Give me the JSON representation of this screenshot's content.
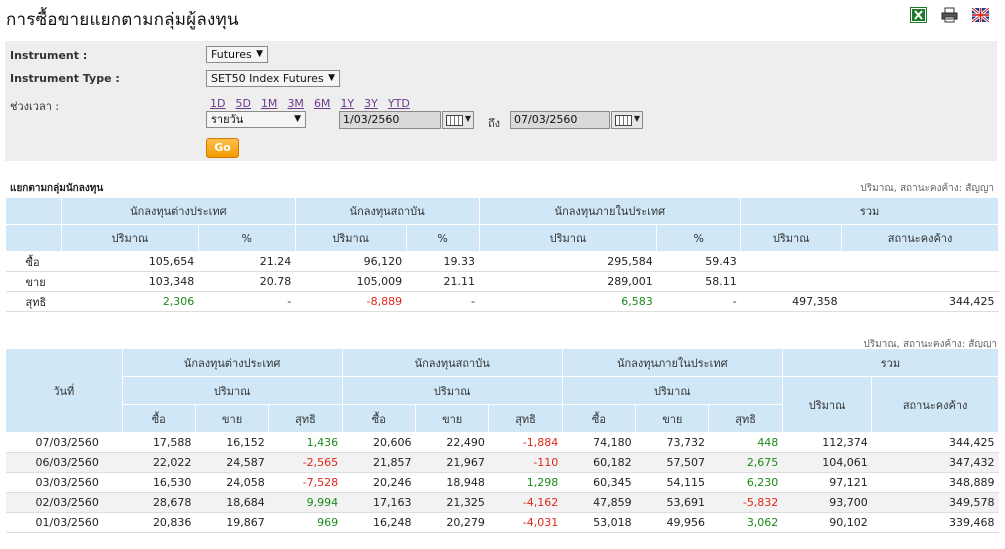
{
  "page": {
    "title": "การซื้อขายแยกตามกลุ่มผู้ลงทุน"
  },
  "icons": [
    "excel-icon",
    "print-icon",
    "uk-flag-icon"
  ],
  "filters": {
    "instrument_label": "Instrument :",
    "instrument_value": "Futures",
    "instrument_type_label": "Instrument Type :",
    "instrument_type_value": "SET50 Index Futures",
    "period_label": "ช่วงเวลา :",
    "periods": [
      "1D",
      "5D",
      "1M",
      "3M",
      "6M",
      "1Y",
      "3Y",
      "YTD"
    ],
    "frequency_value": "รายวัน",
    "from_date": "1/03/2560",
    "to_label": "ถึง",
    "to_date": "07/03/2560",
    "go_label": "Go"
  },
  "summary": {
    "title": "แยกตามกลุ่มนักลงทุน",
    "unit_note": "ปริมาณ, สถานะคงค้าง: สัญญา",
    "groups": [
      "นักลงทุนต่างประเทศ",
      "นักลงทุนสถาบัน",
      "นักลงทุนภายในประเทศ",
      "รวม"
    ],
    "sub_volume": "ปริมาณ",
    "sub_pct": "%",
    "sub_oi": "สถานะคงค้าง",
    "rows": [
      {
        "label": "ซื้อ",
        "f_vol": "105,654",
        "f_pct": "21.24",
        "i_vol": "96,120",
        "i_pct": "19.33",
        "d_vol": "295,584",
        "d_pct": "59.43",
        "t_vol": "",
        "t_oi": ""
      },
      {
        "label": "ขาย",
        "f_vol": "103,348",
        "f_pct": "20.78",
        "i_vol": "105,009",
        "i_pct": "21.11",
        "d_vol": "289,001",
        "d_pct": "58.11",
        "t_vol": "",
        "t_oi": ""
      },
      {
        "label": "สุทธิ",
        "f_vol": "2,306",
        "f_pct": "-",
        "i_vol": "-8,889",
        "i_pct": "-",
        "d_vol": "6,583",
        "d_pct": "-",
        "t_vol": "497,358",
        "t_oi": "344,425"
      }
    ]
  },
  "daily": {
    "unit_note": "ปริมาณ, สถานะคงค้าง: สัญญา",
    "date_header": "วันที่",
    "groups": [
      "นักลงทุนต่างประเทศ",
      "นักลงทุนสถาบัน",
      "นักลงทุนภายในประเทศ",
      "รวม"
    ],
    "sub_volume": "ปริมาณ",
    "buy": "ซื้อ",
    "sell": "ขาย",
    "net": "สุทธิ",
    "total_vol": "ปริมาณ",
    "total_oi": "สถานะคงค้าง",
    "rows": [
      {
        "date": "07/03/2560",
        "f_buy": "17,588",
        "f_sell": "16,152",
        "f_net": "1,436",
        "i_buy": "20,606",
        "i_sell": "22,490",
        "i_net": "-1,884",
        "d_buy": "74,180",
        "d_sell": "73,732",
        "d_net": "448",
        "t_vol": "112,374",
        "t_oi": "344,425"
      },
      {
        "date": "06/03/2560",
        "f_buy": "22,022",
        "f_sell": "24,587",
        "f_net": "-2,565",
        "i_buy": "21,857",
        "i_sell": "21,967",
        "i_net": "-110",
        "d_buy": "60,182",
        "d_sell": "57,507",
        "d_net": "2,675",
        "t_vol": "104,061",
        "t_oi": "347,432"
      },
      {
        "date": "03/03/2560",
        "f_buy": "16,530",
        "f_sell": "24,058",
        "f_net": "-7,528",
        "i_buy": "20,246",
        "i_sell": "18,948",
        "i_net": "1,298",
        "d_buy": "60,345",
        "d_sell": "54,115",
        "d_net": "6,230",
        "t_vol": "97,121",
        "t_oi": "348,889"
      },
      {
        "date": "02/03/2560",
        "f_buy": "28,678",
        "f_sell": "18,684",
        "f_net": "9,994",
        "i_buy": "17,163",
        "i_sell": "21,325",
        "i_net": "-4,162",
        "d_buy": "47,859",
        "d_sell": "53,691",
        "d_net": "-5,832",
        "t_vol": "93,700",
        "t_oi": "349,578"
      },
      {
        "date": "01/03/2560",
        "f_buy": "20,836",
        "f_sell": "19,867",
        "f_net": "969",
        "i_buy": "16,248",
        "i_sell": "20,279",
        "i_net": "-4,031",
        "d_buy": "53,018",
        "d_sell": "49,956",
        "d_net": "3,062",
        "t_vol": "90,102",
        "t_oi": "339,468"
      }
    ]
  },
  "colors": {
    "header_bg": "#cfe7f7",
    "panel_bg": "#eeeeee",
    "positive": "#1a8a1a",
    "negative": "#e0261b",
    "go_button": "#f39a00",
    "link": "#6b3a8c"
  }
}
